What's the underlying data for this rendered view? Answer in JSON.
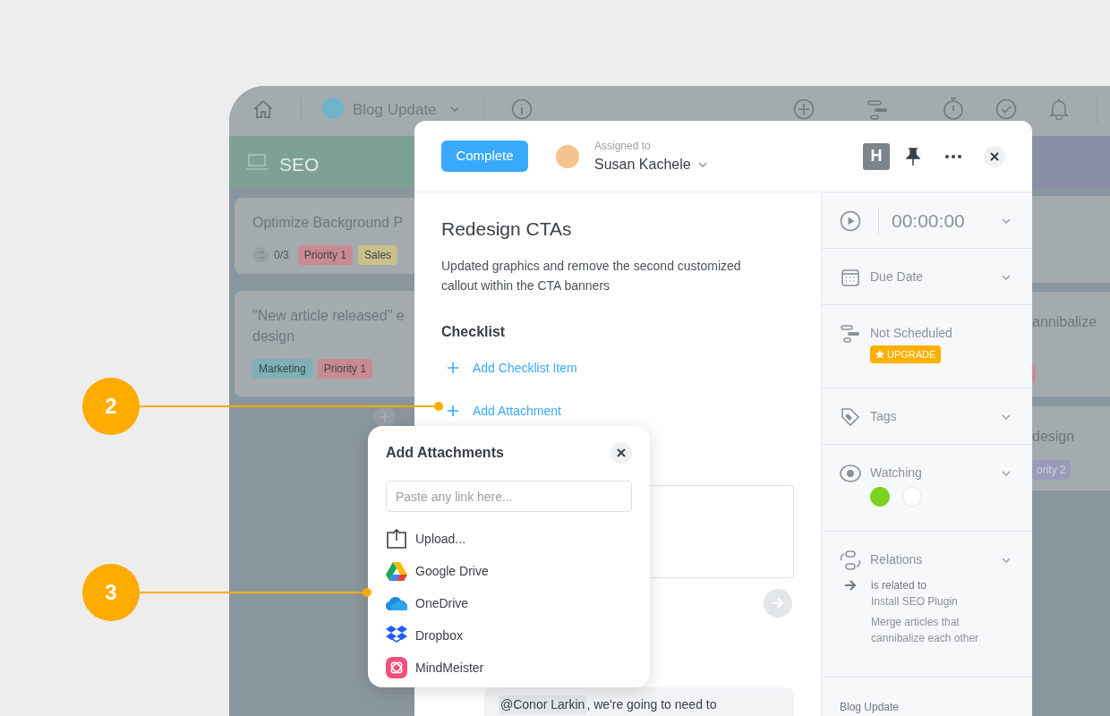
{
  "callouts": [
    {
      "number": "2"
    },
    {
      "number": "3"
    }
  ],
  "toolbar": {
    "project": "Blog Update"
  },
  "board": {
    "left_column": {
      "title": "SEO",
      "cards": [
        {
          "title_lines": [
            "Optimize Background P"
          ],
          "checklist": "0/3",
          "tags": [
            {
              "label": "Priority 1",
              "color": "#c98a93"
            },
            {
              "label": "Sales",
              "color": "#c8c08a"
            }
          ]
        },
        {
          "title_lines": [
            "\"New article released\" e",
            "design"
          ],
          "tags": [
            {
              "label": "Marketing",
              "color": "#7fb0b5"
            },
            {
              "label": "Priority 1",
              "color": "#c98a93"
            }
          ]
        }
      ]
    },
    "right_cards": [
      {
        "text": "annibalize"
      },
      {
        "text": "design",
        "tag": "ority 2"
      }
    ]
  },
  "task": {
    "complete_button": "Complete",
    "assigned_label": "Assigned to",
    "assignee": "Susan Kachele",
    "title": "Redesign CTAs",
    "description": "Updated graphics and remove the second customized callout within the CTA banners",
    "checklist_heading": "Checklist",
    "add_checklist": "Add Checklist Item",
    "add_attachment": "Add Attachment",
    "comment_mention": "@Conor Larkin",
    "comment_text": ", we're going to need to"
  },
  "header_actions": {
    "badge": "H"
  },
  "sidebar": [
    {
      "kind": "timer",
      "label": "00:00:00"
    },
    {
      "kind": "due_date",
      "label": "Due Date"
    },
    {
      "kind": "schedule",
      "label": "Not Scheduled",
      "badge": "UPGRADE"
    },
    {
      "kind": "tags",
      "label": "Tags"
    },
    {
      "kind": "watching",
      "label": "Watching"
    },
    {
      "kind": "relations",
      "label": "Relations",
      "relation": "is related to",
      "items": [
        "Install SEO Plugin",
        "Merge articles that cannibalize each other"
      ]
    }
  ],
  "sidebar_footer": "Blog Update",
  "attachments_popup": {
    "title": "Add Attachments",
    "placeholder": "Paste any link here...",
    "options": [
      {
        "kind": "upload",
        "label": "Upload..."
      },
      {
        "kind": "google_drive",
        "label": "Google Drive"
      },
      {
        "kind": "onedrive",
        "label": "OneDrive"
      },
      {
        "kind": "dropbox",
        "label": "Dropbox"
      },
      {
        "kind": "mindmeister",
        "label": "MindMeister"
      }
    ]
  }
}
